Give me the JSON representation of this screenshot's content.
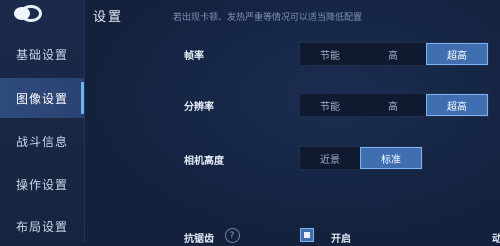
{
  "page": {
    "title": "设置",
    "hint": "若出现卡顿、发热严重等情况可以适当降低配置"
  },
  "sidebar": {
    "items": [
      {
        "label": "基础设置",
        "active": false
      },
      {
        "label": "图像设置",
        "active": true
      },
      {
        "label": "战斗信息",
        "active": false
      },
      {
        "label": "操作设置",
        "active": false
      },
      {
        "label": "布局设置",
        "active": false
      }
    ]
  },
  "settings": {
    "frame_rate": {
      "label": "帧率",
      "options": [
        "节能",
        "高",
        "超高"
      ],
      "selected": "超高"
    },
    "resolution": {
      "label": "分辨率",
      "options": [
        "节能",
        "高",
        "超高"
      ],
      "selected": "超高"
    },
    "camera_height": {
      "label": "相机高度",
      "options": [
        "近景",
        "标准"
      ],
      "selected": "标准"
    },
    "antialiasing": {
      "label": "抗锯齿",
      "help_icon": "?",
      "checkbox_label": "开启",
      "checked": true,
      "next_label_fragment": "动"
    }
  },
  "colors": {
    "accent": "#3f6fb1",
    "accent_border": "#7fb3ef",
    "sidebar_active": "#2e4a7c",
    "background": "#14213d"
  },
  "icons": {
    "back": "back-swirl-icon",
    "help": "question-diamond-icon"
  }
}
